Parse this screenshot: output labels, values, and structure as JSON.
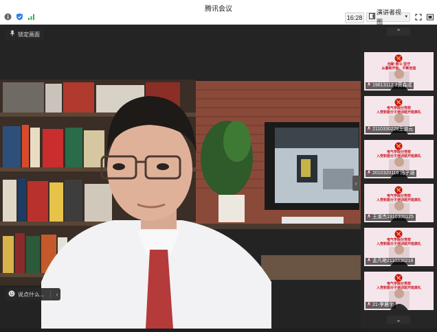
{
  "window": {
    "title": "腾讯会议",
    "time": "16:28",
    "view_label": "演讲者视图"
  },
  "main": {
    "lock_label": "锁定画面",
    "chat_placeholder": "说点什么..."
  },
  "participants": [
    {
      "name": "19613112 3黄森成",
      "slide_text": [
        "创新·奋斗·坚守",
        "从最新开始，不断创造"
      ]
    },
    {
      "name": "2110330228王道元",
      "slide_text": [
        "电气学院分党校",
        "入党积极分子培训班开班典礼"
      ]
    },
    {
      "name": "2010320116 冯子涵",
      "slide_text": [
        "电气学院分党校",
        "入党积极分子培训班开班典礼"
      ]
    },
    {
      "name": "王淑杰1910300125",
      "slide_text": [
        "电气学院分党校",
        "入党积极分子培训班开班典礼"
      ]
    },
    {
      "name": "孟凡艳2110330218",
      "slide_text": [
        "电气学院分党校",
        "入党积极分子培训班开班典礼"
      ]
    },
    {
      "name": "21-李晨宇",
      "slide_text": [
        "电气学院分党校",
        "入党积极分子培训班开班典礼"
      ]
    }
  ],
  "colors": {
    "accent_red": "#c8141e",
    "panel_bg": "#262626"
  }
}
